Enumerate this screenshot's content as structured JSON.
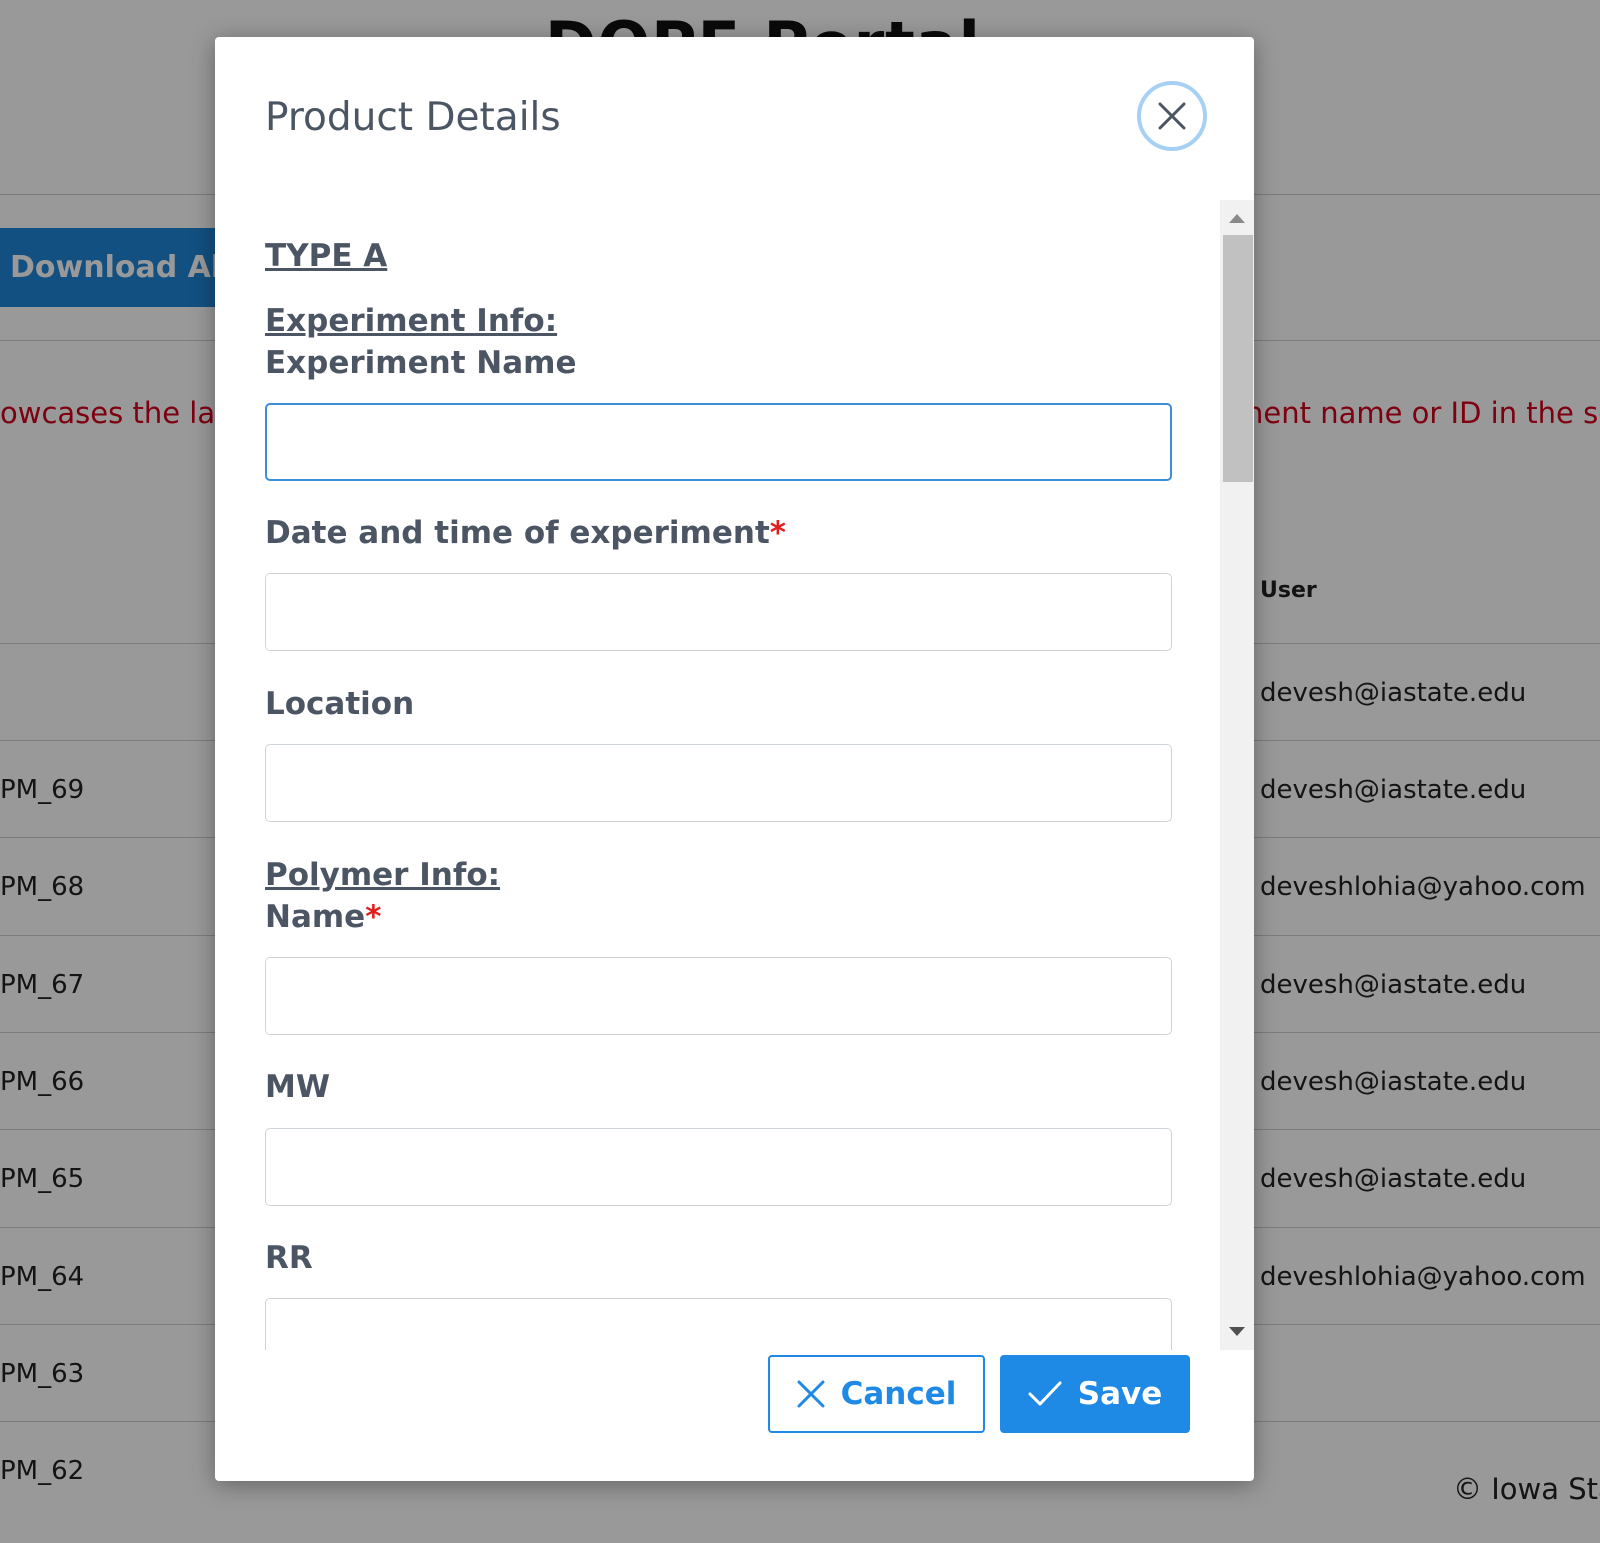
{
  "background": {
    "title": "DOPE Portal",
    "download_label": "Download All",
    "banner_left": "owcases the lat",
    "banner_right": "nent name or ID in the se",
    "user_header": "User",
    "rows": [
      {
        "id": "",
        "user": "devesh@iastate.edu"
      },
      {
        "id": "PM_69",
        "user": "devesh@iastate.edu"
      },
      {
        "id": "PM_68",
        "user": "deveshlohia@yahoo.com"
      },
      {
        "id": "PM_67",
        "user": "devesh@iastate.edu"
      },
      {
        "id": "PM_66",
        "user": "devesh@iastate.edu"
      },
      {
        "id": "PM_65",
        "user": "devesh@iastate.edu"
      },
      {
        "id": "PM_64",
        "user": "deveshlohia@yahoo.com"
      },
      {
        "id": "PM_63",
        "user": ""
      },
      {
        "id": "PM_62",
        "user": ""
      }
    ],
    "footer": "© Iowa Sta"
  },
  "modal": {
    "title": "Product Details",
    "close_icon": "close-icon",
    "type_heading": "TYPE A",
    "experiment_section": "Experiment Info:",
    "polymer_section": "Polymer Info:",
    "required_mark": "*",
    "fields": {
      "experiment_name": {
        "label": "Experiment Name",
        "value": ""
      },
      "datetime": {
        "label": "Date and time of experiment",
        "value": ""
      },
      "location": {
        "label": "Location",
        "value": ""
      },
      "polymer_name": {
        "label": "Name",
        "value": ""
      },
      "mw": {
        "label": "MW",
        "value": ""
      },
      "rr": {
        "label": "RR",
        "value": ""
      }
    },
    "cancel_label": "Cancel",
    "save_label": "Save",
    "colors": {
      "primary": "#1f8ae6",
      "required": "#e11d1d",
      "focus_border": "#3b8fd9"
    }
  }
}
